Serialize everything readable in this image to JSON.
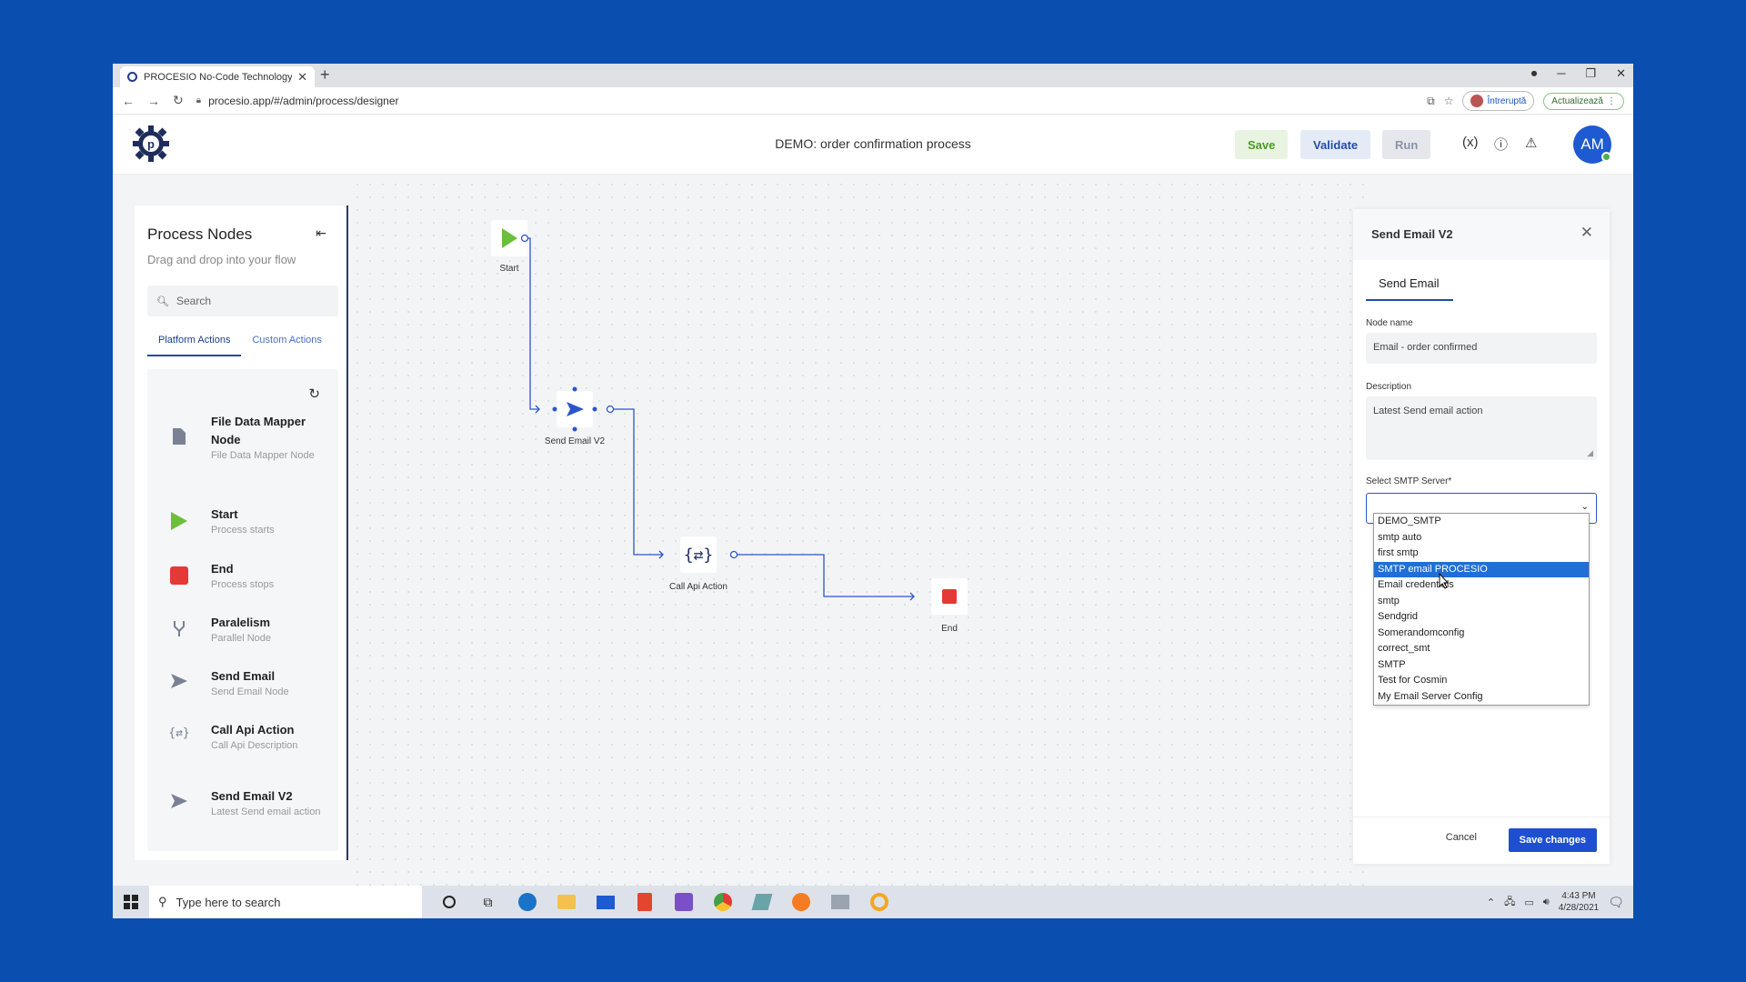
{
  "browser": {
    "tab_title": "PROCESIO No-Code Technology",
    "url": "procesio.app/#/admin/process/designer",
    "profile_chip": "Întreruptă",
    "update_chip": "Actualizează"
  },
  "header": {
    "process_title": "DEMO: order confirmation process",
    "save": "Save",
    "validate": "Validate",
    "run": "Run",
    "variables": "(x)",
    "avatar": "AM"
  },
  "sidebar": {
    "title": "Process Nodes",
    "subtitle": "Drag and drop into your flow",
    "search_placeholder": "Search",
    "tabs": [
      "Platform Actions",
      "Custom Actions"
    ],
    "items": [
      {
        "name": "File Data Mapper Node",
        "desc": "File Data Mapper Node",
        "icon": "file-icon"
      },
      {
        "name": "Start",
        "desc": "Process starts",
        "icon": "play-icon"
      },
      {
        "name": "End",
        "desc": "Process stops",
        "icon": "stop-icon"
      },
      {
        "name": "Paralelism",
        "desc": "Parallel Node",
        "icon": "fork-icon"
      },
      {
        "name": "Send Email",
        "desc": "Send Email Node",
        "icon": "send-icon"
      },
      {
        "name": "Call Api Action",
        "desc": "Call Api Description",
        "icon": "api-icon"
      },
      {
        "name": "Send Email V2",
        "desc": "Latest Send email action",
        "icon": "send-icon"
      }
    ]
  },
  "canvas": {
    "nodes": {
      "start": "Start",
      "send_email": "Send Email V2",
      "call_api": "Call Api Action",
      "end": "End"
    }
  },
  "panel": {
    "title": "Send Email V2",
    "tab": "Send Email",
    "node_name_label": "Node name",
    "node_name_value": "Email - order confirmed",
    "description_label": "Description",
    "description_value": "Latest Send email action",
    "smtp_label": "Select SMTP Server*",
    "smtp_options": [
      "DEMO_SMTP",
      "smtp auto",
      "first smtp",
      "SMTP email PROCESIO",
      "Email credentials",
      "smtp",
      "Sendgrid",
      "Somerandomconfig",
      "correct_smt",
      "SMTP",
      "Test for Cosmin",
      "My Email Server Config"
    ],
    "smtp_highlighted": "SMTP email PROCESIO",
    "cancel": "Cancel",
    "save_changes": "Save changes"
  },
  "taskbar": {
    "search_placeholder": "Type here to search",
    "time": "4:43 PM",
    "date": "4/28/2021"
  },
  "colors": {
    "background": "#0a4fb0",
    "accent": "#1f4fd1",
    "start_green": "#6cbf3a",
    "end_red": "#e53935"
  }
}
